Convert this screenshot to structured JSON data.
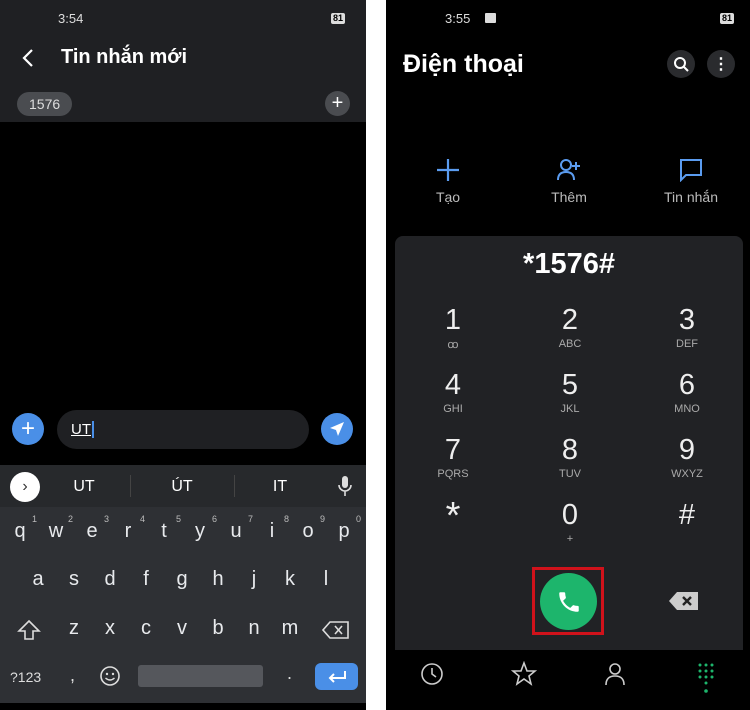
{
  "messages": {
    "status_time": "3:54",
    "battery": "81",
    "title": "Tin nhắn mới",
    "recipient_chip": "1576",
    "input_value": "UT",
    "suggestions": [
      "UT",
      "ÚT",
      "IT"
    ],
    "keyboard": {
      "row1": [
        [
          "q",
          "1"
        ],
        [
          "w",
          "2"
        ],
        [
          "e",
          "3"
        ],
        [
          "r",
          "4"
        ],
        [
          "t",
          "5"
        ],
        [
          "y",
          "6"
        ],
        [
          "u",
          "7"
        ],
        [
          "i",
          "8"
        ],
        [
          "o",
          "9"
        ],
        [
          "p",
          "0"
        ]
      ],
      "row2": [
        "a",
        "s",
        "d",
        "f",
        "g",
        "h",
        "j",
        "k",
        "l"
      ],
      "row3": [
        "z",
        "x",
        "c",
        "v",
        "b",
        "n",
        "m"
      ],
      "symbols_label": "?123",
      "comma": ",",
      "period": "."
    },
    "accent": "#4a8fe7"
  },
  "dialer": {
    "status_time": "3:55",
    "battery": "81",
    "title": "Điện thoại",
    "actions": [
      {
        "label": "Tạo",
        "icon": "plus-icon"
      },
      {
        "label": "Thêm",
        "icon": "add-contact-icon"
      },
      {
        "label": "Tin nhắn",
        "icon": "message-icon"
      }
    ],
    "number": "*1576#",
    "keys": [
      [
        "1",
        "ꝏ"
      ],
      [
        "2",
        "ABC"
      ],
      [
        "3",
        "DEF"
      ],
      [
        "4",
        "GHI"
      ],
      [
        "5",
        "JKL"
      ],
      [
        "6",
        "MNO"
      ],
      [
        "7",
        "PQRS"
      ],
      [
        "8",
        "TUV"
      ],
      [
        "9",
        "WXYZ"
      ],
      [
        "*",
        ""
      ],
      [
        "0",
        "+"
      ],
      [
        "#",
        ""
      ]
    ],
    "call_color": "#1db56c",
    "highlight_color": "#d0121b",
    "nav": [
      "recents-icon",
      "favorites-icon",
      "contacts-icon",
      "keypad-icon"
    ]
  }
}
